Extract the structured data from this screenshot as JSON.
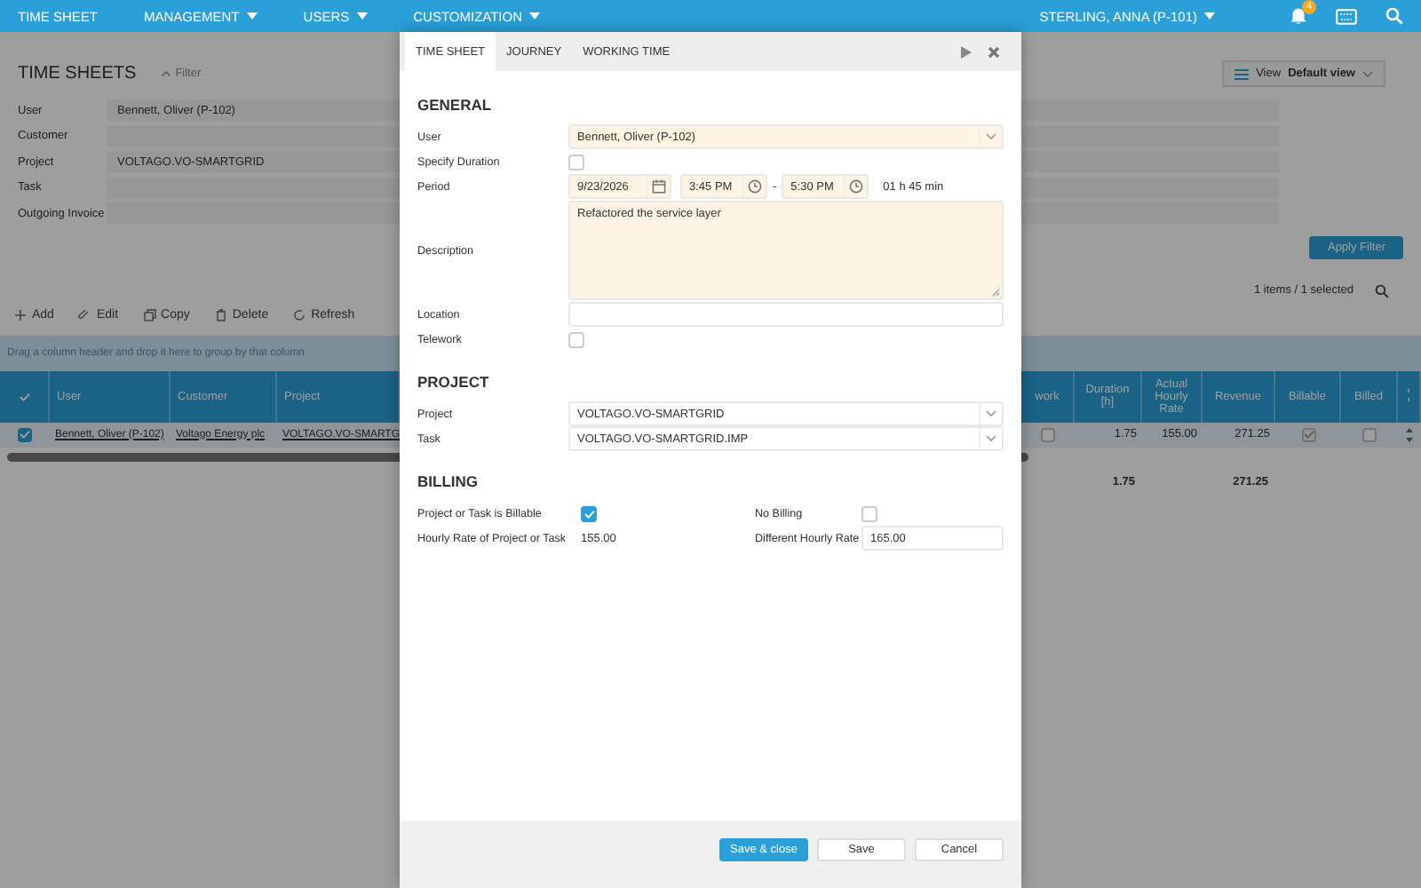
{
  "top_nav": {
    "items": [
      {
        "label": "TIME SHEET",
        "dropdown": false
      },
      {
        "label": "MANAGEMENT",
        "dropdown": true
      },
      {
        "label": "USERS",
        "dropdown": true
      },
      {
        "label": "CUSTOMIZATION",
        "dropdown": true
      }
    ],
    "user": "STERLING, ANNA (P-101)",
    "notifications": "4"
  },
  "page": {
    "title": "TIME SHEETS",
    "filter_toggle": "Filter",
    "filters": [
      {
        "label": "User",
        "value": "Bennett, Oliver (P-102)"
      },
      {
        "label": "Customer"
      },
      {
        "label": "Project",
        "value": "VOLTAGO.VO-SMARTGRID"
      },
      {
        "label": "Task"
      },
      {
        "label": "Outgoing Invoice"
      }
    ],
    "view": {
      "label": "View",
      "value": "Default view"
    },
    "apply_button": "Apply Filter",
    "count": "1 items / 1 selected",
    "toolbar": [
      "Add",
      "Edit",
      "Copy",
      "Delete",
      "Refresh"
    ],
    "group_hint": "Drag a column header and drop it here to group by that column",
    "table": {
      "columns": [
        "User",
        "Customer",
        "Project",
        "work",
        "Duration [h]",
        "Actual Hourly Rate",
        "Revenue",
        "Billable",
        "Billed"
      ],
      "rows": [
        {
          "selected": true,
          "user": "Bennett, Oliver (P-102)",
          "customer": "Voltago Energy plc",
          "project": "VOLTAGO.VO-SMARTG",
          "telework": false,
          "duration": "1.75",
          "rate": "155.00",
          "revenue": "271.25",
          "billable": true,
          "billed": false
        }
      ],
      "totals": {
        "duration": "1.75",
        "revenue": "271.25"
      }
    }
  },
  "dialog": {
    "tabs": [
      {
        "label": "TIME SHEET",
        "selected": true
      },
      {
        "label": "JOURNEY",
        "selected": false
      },
      {
        "label": "WORKING TIME",
        "selected": false
      }
    ],
    "sections": [
      {
        "title": "GENERAL",
        "fields": [
          {
            "kind": "select",
            "label": "User",
            "value": "Bennett, Oliver (P-102)",
            "required": true
          },
          {
            "kind": "checkbox",
            "label": "Specify Duration",
            "checked": false
          },
          {
            "kind": "period",
            "label": "Period",
            "date": "9/23/2026",
            "start": "3:45 PM",
            "separator": "-",
            "end": "5:30 PM",
            "duration": "01 h 45 min"
          },
          {
            "kind": "textarea",
            "label": "Description",
            "value": "Refactored the service layer",
            "required": true
          },
          {
            "kind": "text",
            "label": "Location",
            "required": false
          },
          {
            "kind": "checkbox",
            "label": "Telework",
            "checked": false
          }
        ]
      },
      {
        "title": "PROJECT",
        "fields": [
          {
            "kind": "select",
            "label": "Project",
            "value": "VOLTAGO.VO-SMARTGRID",
            "required": false
          },
          {
            "kind": "select",
            "label": "Task",
            "value": "VOLTAGO.VO-SMARTGRID.IMP",
            "required": false
          }
        ]
      },
      {
        "title": "BILLING",
        "fields": [
          {
            "kind": "pair",
            "left": {
              "kind": "checkbox",
              "label": "Project or Task is Billable",
              "checked": true
            },
            "right": {
              "kind": "checkbox",
              "label": "No Billing",
              "checked": false
            }
          },
          {
            "kind": "pair",
            "left": {
              "kind": "readonly",
              "label": "Hourly Rate of Project or Task",
              "value": "155.00"
            },
            "right": {
              "kind": "text",
              "label": "Different Hourly Rate",
              "value": "165.00",
              "required": false
            }
          }
        ]
      }
    ],
    "buttons": [
      {
        "label": "Save & close",
        "primary": true
      },
      {
        "label": "Save",
        "primary": false
      },
      {
        "label": "Cancel",
        "primary": false
      }
    ]
  }
}
